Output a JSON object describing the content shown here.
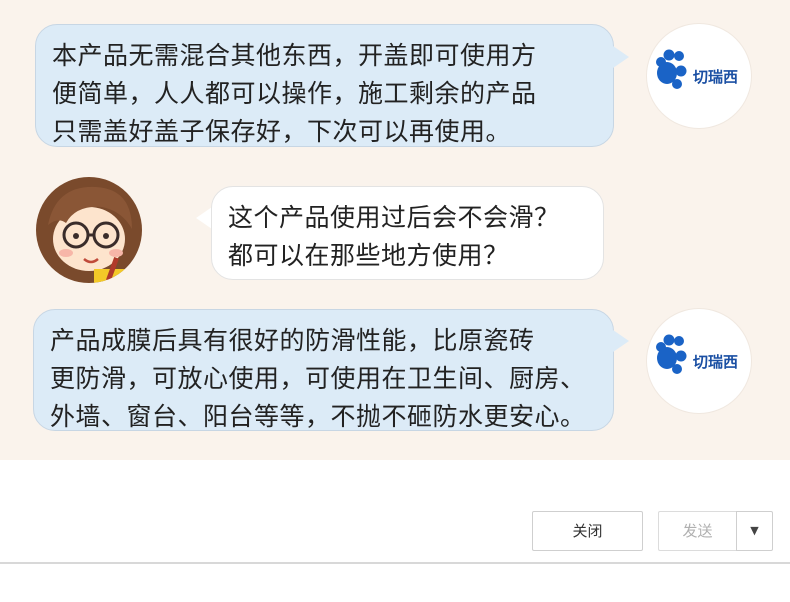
{
  "chat": {
    "messages": [
      {
        "sender": "切瑞西",
        "lines": [
          "本产品无需混合其他东西，开盖即可使用方",
          "便简单，人人都可以操作，施工剩余的产品",
          "只需盖好盖子保存好，下次可以再使用。"
        ]
      },
      {
        "sender": "user",
        "lines": [
          "这个产品使用过后会不会滑？",
          "都可以在那些地方使用？"
        ]
      },
      {
        "sender": "切瑞西",
        "lines": [
          "产品成膜后具有很好的防滑性能，比原瓷砖",
          "更防滑，可放心使用，可使用在卫生间、厨房、",
          "外墙、窗台、阳台等等，不抛不砸防水更安心。"
        ]
      }
    ],
    "brand_logo_text": "切瑞西",
    "colors": {
      "background": "#faf3ec",
      "brand_bubble": "#dcebf7",
      "user_bubble": "#ffffff",
      "brand_blue": "#1a4fa3"
    }
  },
  "toolbar": {
    "close_label": "关闭",
    "send_label": "发送",
    "dropdown_icon": "▼"
  },
  "icons": {
    "brand_avatar": "brand-logo-icon",
    "user_avatar": "cartoon-girl-avatar-icon"
  }
}
